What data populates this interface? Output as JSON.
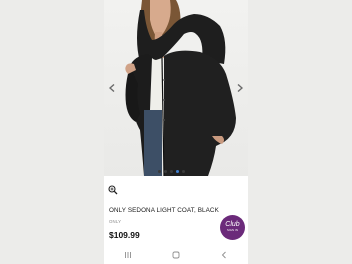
{
  "product": {
    "title": "ONLY SEDONA LIGHT COAT, BLACK",
    "brand": "ONLY",
    "price": "$109.99"
  },
  "club_badge": {
    "logo_text": "Club",
    "sign_in_label": "SIGN IN"
  },
  "gallery": {
    "prev_icon": "chevron-left-icon",
    "next_icon": "chevron-right-icon",
    "dots_total": 5,
    "active_dot": 3
  },
  "icons": {
    "zoom": "zoom-in-icon",
    "nav_recents": "recents-icon",
    "nav_home": "home-icon",
    "nav_back": "back-icon"
  },
  "colors": {
    "club_badge": "#6b2a7a",
    "active_dot": "#3f7fd0"
  }
}
